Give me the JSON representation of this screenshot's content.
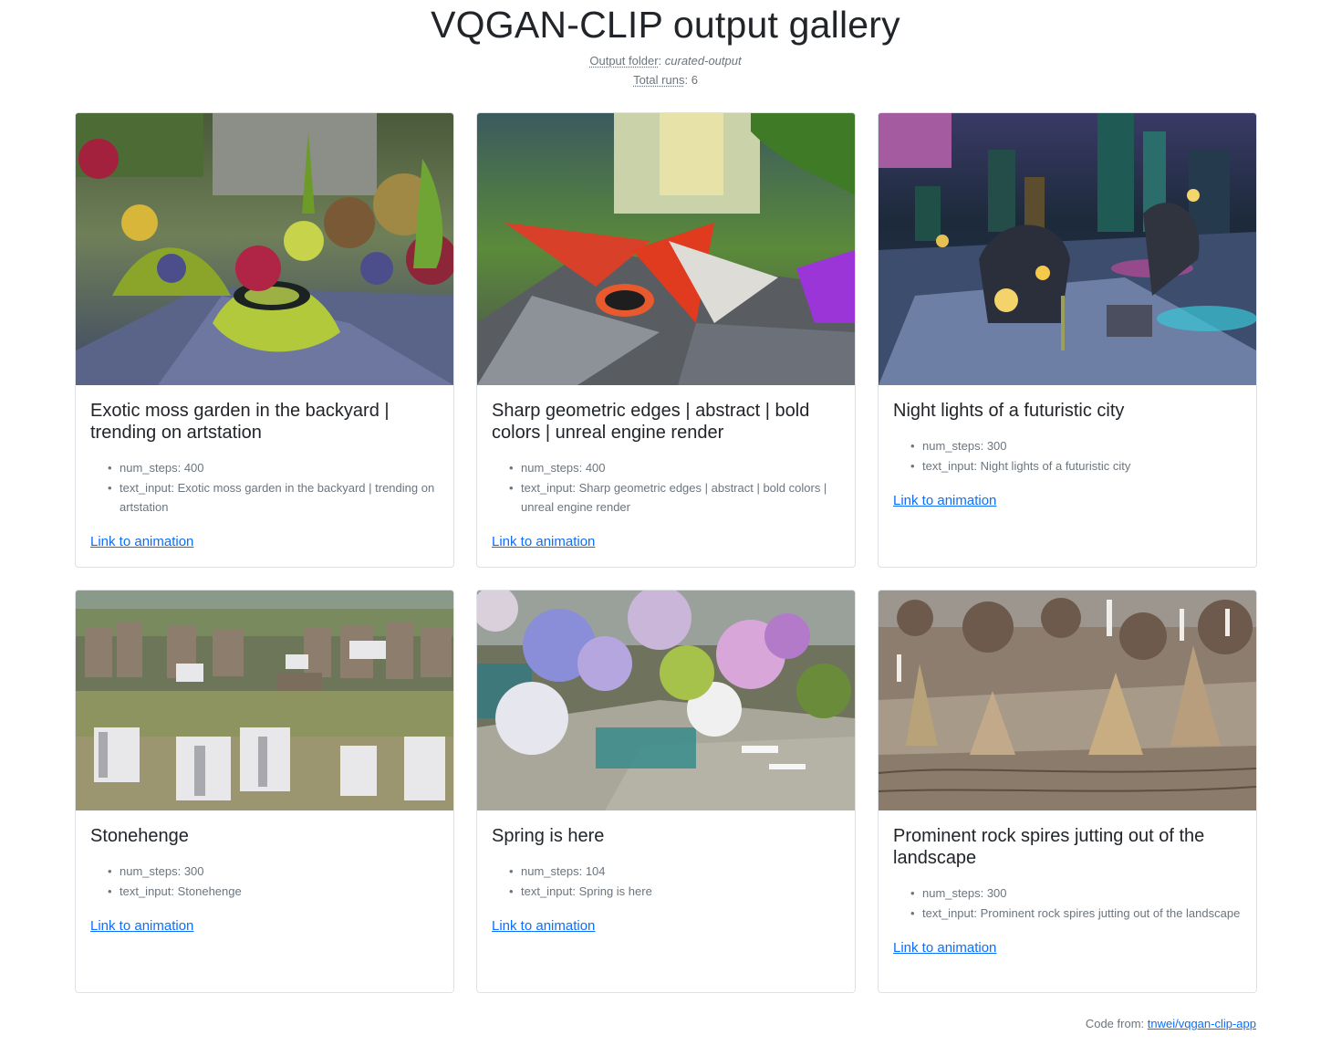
{
  "page": {
    "title": "VQGAN-CLIP output gallery",
    "output_folder_label": "Output folder",
    "output_folder_value": "curated-output",
    "total_runs_label": "Total runs",
    "total_runs_value": "6"
  },
  "cards": [
    {
      "title": "Exotic moss garden in the backyard | trending on artstation",
      "image_alt": "exotic moss garden artwork",
      "num_steps": "num_steps: 400",
      "text_input": "text_input: Exotic moss garden in the backyard | trending on artstation",
      "link": "Link to animation"
    },
    {
      "title": "Sharp geometric edges | abstract | bold colors | unreal engine render",
      "image_alt": "sharp geometric abstract artwork",
      "num_steps": "num_steps: 400",
      "text_input": "text_input: Sharp geometric edges | abstract | bold colors | unreal engine render",
      "link": "Link to animation"
    },
    {
      "title": "Night lights of a futuristic city",
      "image_alt": "futuristic city night artwork",
      "num_steps": "num_steps: 300",
      "text_input": "text_input: Night lights of a futuristic city",
      "link": "Link to animation"
    },
    {
      "title": "Stonehenge",
      "image_alt": "stonehenge artwork",
      "num_steps": "num_steps: 300",
      "text_input": "text_input: Stonehenge",
      "link": "Link to animation"
    },
    {
      "title": "Spring is here",
      "image_alt": "spring blossoms artwork",
      "num_steps": "num_steps: 104",
      "text_input": "text_input: Spring is here",
      "link": "Link to animation"
    },
    {
      "title": "Prominent rock spires jutting out of the landscape",
      "image_alt": "rock spires landscape artwork",
      "num_steps": "num_steps: 300",
      "text_input": "text_input: Prominent rock spires jutting out of the landscape",
      "link": "Link to animation"
    }
  ],
  "footer": {
    "prefix": "Code from:",
    "link_text": "tnwei/vqgan-clip-app"
  },
  "colors": {
    "link": "#0d6efd",
    "muted": "#6c757d",
    "border": "#dee2e6",
    "text": "#212529"
  }
}
